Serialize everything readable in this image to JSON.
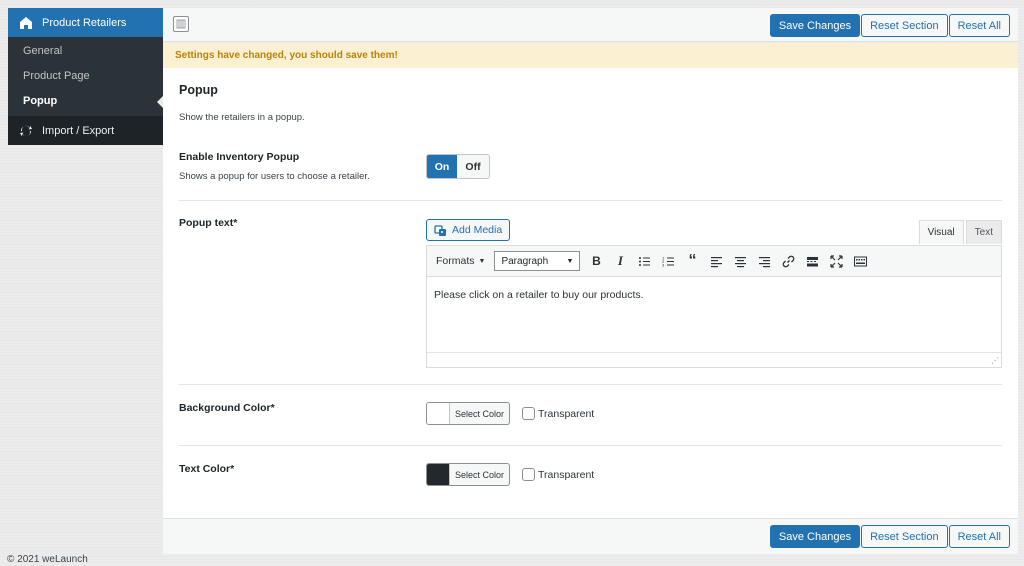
{
  "sidebar": {
    "header": {
      "label": "Product Retailers",
      "icon": "home-icon"
    },
    "items": [
      {
        "label": "General",
        "active": false
      },
      {
        "label": "Product Page",
        "active": false
      },
      {
        "label": "Popup",
        "active": true
      }
    ],
    "footer": {
      "label": "Import / Export",
      "icon": "refresh-icon"
    }
  },
  "toolbar": {
    "save_label": "Save Changes",
    "reset_section_label": "Reset Section",
    "reset_all_label": "Reset All"
  },
  "notice": "Settings have changed, you should save them!",
  "section": {
    "title": "Popup",
    "description": "Show the retailers in a popup."
  },
  "fields": {
    "enable_popup": {
      "label": "Enable Inventory Popup",
      "description": "Shows a popup for users to choose a retailer.",
      "on_label": "On",
      "off_label": "Off",
      "value": "On"
    },
    "popup_text": {
      "label": "Popup text*",
      "add_media_label": "Add Media",
      "tab_visual": "Visual",
      "tab_text": "Text",
      "formats_label": "Formats",
      "paragraph_label": "Paragraph",
      "content": "Please click on a retailer to buy our products."
    },
    "background_color": {
      "label": "Background Color*",
      "button_label": "Select Color",
      "swatch_color": "#ffffff",
      "transparent_label": "Transparent"
    },
    "text_color": {
      "label": "Text Color*",
      "button_label": "Select Color",
      "swatch_color": "#23282d",
      "transparent_label": "Transparent"
    }
  },
  "footer": "© 2021 weLaunch",
  "colors": {
    "accent": "#2271b1",
    "sidebar_bg": "#2c3338",
    "notice_bg": "#fcf0d2",
    "notice_text": "#b8830a"
  }
}
